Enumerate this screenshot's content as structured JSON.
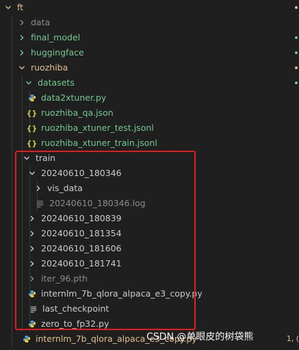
{
  "explorer": {
    "root": "ft",
    "items": [
      {
        "label": "data",
        "kind": "folder",
        "expanded": false
      },
      {
        "label": "final_model",
        "kind": "folder",
        "expanded": false
      },
      {
        "label": "huggingface",
        "kind": "folder",
        "expanded": false
      },
      {
        "label": "ruozhiba",
        "kind": "folder",
        "expanded": true
      },
      {
        "label": "datasets",
        "kind": "folder",
        "expanded": true
      },
      {
        "label": "data2xtuner.py",
        "kind": "python"
      },
      {
        "label": "ruozhiba_qa.json",
        "kind": "json"
      },
      {
        "label": "ruozhiba_xtuner_test.jsonl",
        "kind": "json"
      },
      {
        "label": "ruozhiba_xtuner_train.jsonl",
        "kind": "json"
      },
      {
        "label": "train",
        "kind": "folder",
        "expanded": true
      },
      {
        "label": "20240610_180346",
        "kind": "folder",
        "expanded": true
      },
      {
        "label": "vis_data",
        "kind": "folder",
        "expanded": false
      },
      {
        "label": "20240610_180346.log",
        "kind": "log"
      },
      {
        "label": "20240610_180839",
        "kind": "folder",
        "expanded": false
      },
      {
        "label": "20240610_181354",
        "kind": "folder",
        "expanded": false
      },
      {
        "label": "20240610_181606",
        "kind": "folder",
        "expanded": false
      },
      {
        "label": "20240610_181741",
        "kind": "folder",
        "expanded": false
      },
      {
        "label": "iter_96.pth",
        "kind": "folder",
        "expanded": false
      },
      {
        "label": "internlm_7b_qlora_alpaca_e3_copy.py",
        "kind": "python"
      },
      {
        "label": "last_checkpoint",
        "kind": "text"
      },
      {
        "label": "zero_to_fp32.py",
        "kind": "python"
      },
      {
        "label": "internlm_7b_qlora_alpaca_e3_copy.py",
        "kind": "python"
      }
    ],
    "partial_right": "1, ("
  },
  "watermark": "CSDN @单眼皮的树袋熊",
  "colors": {
    "background": "#1f1f1f",
    "modified_green": "#73c991",
    "untracked_yellow": "#e2c08d",
    "highlight_red": "#e02020",
    "python_blue": "#4a9fd6",
    "json_yellow": "#cbcb41"
  }
}
